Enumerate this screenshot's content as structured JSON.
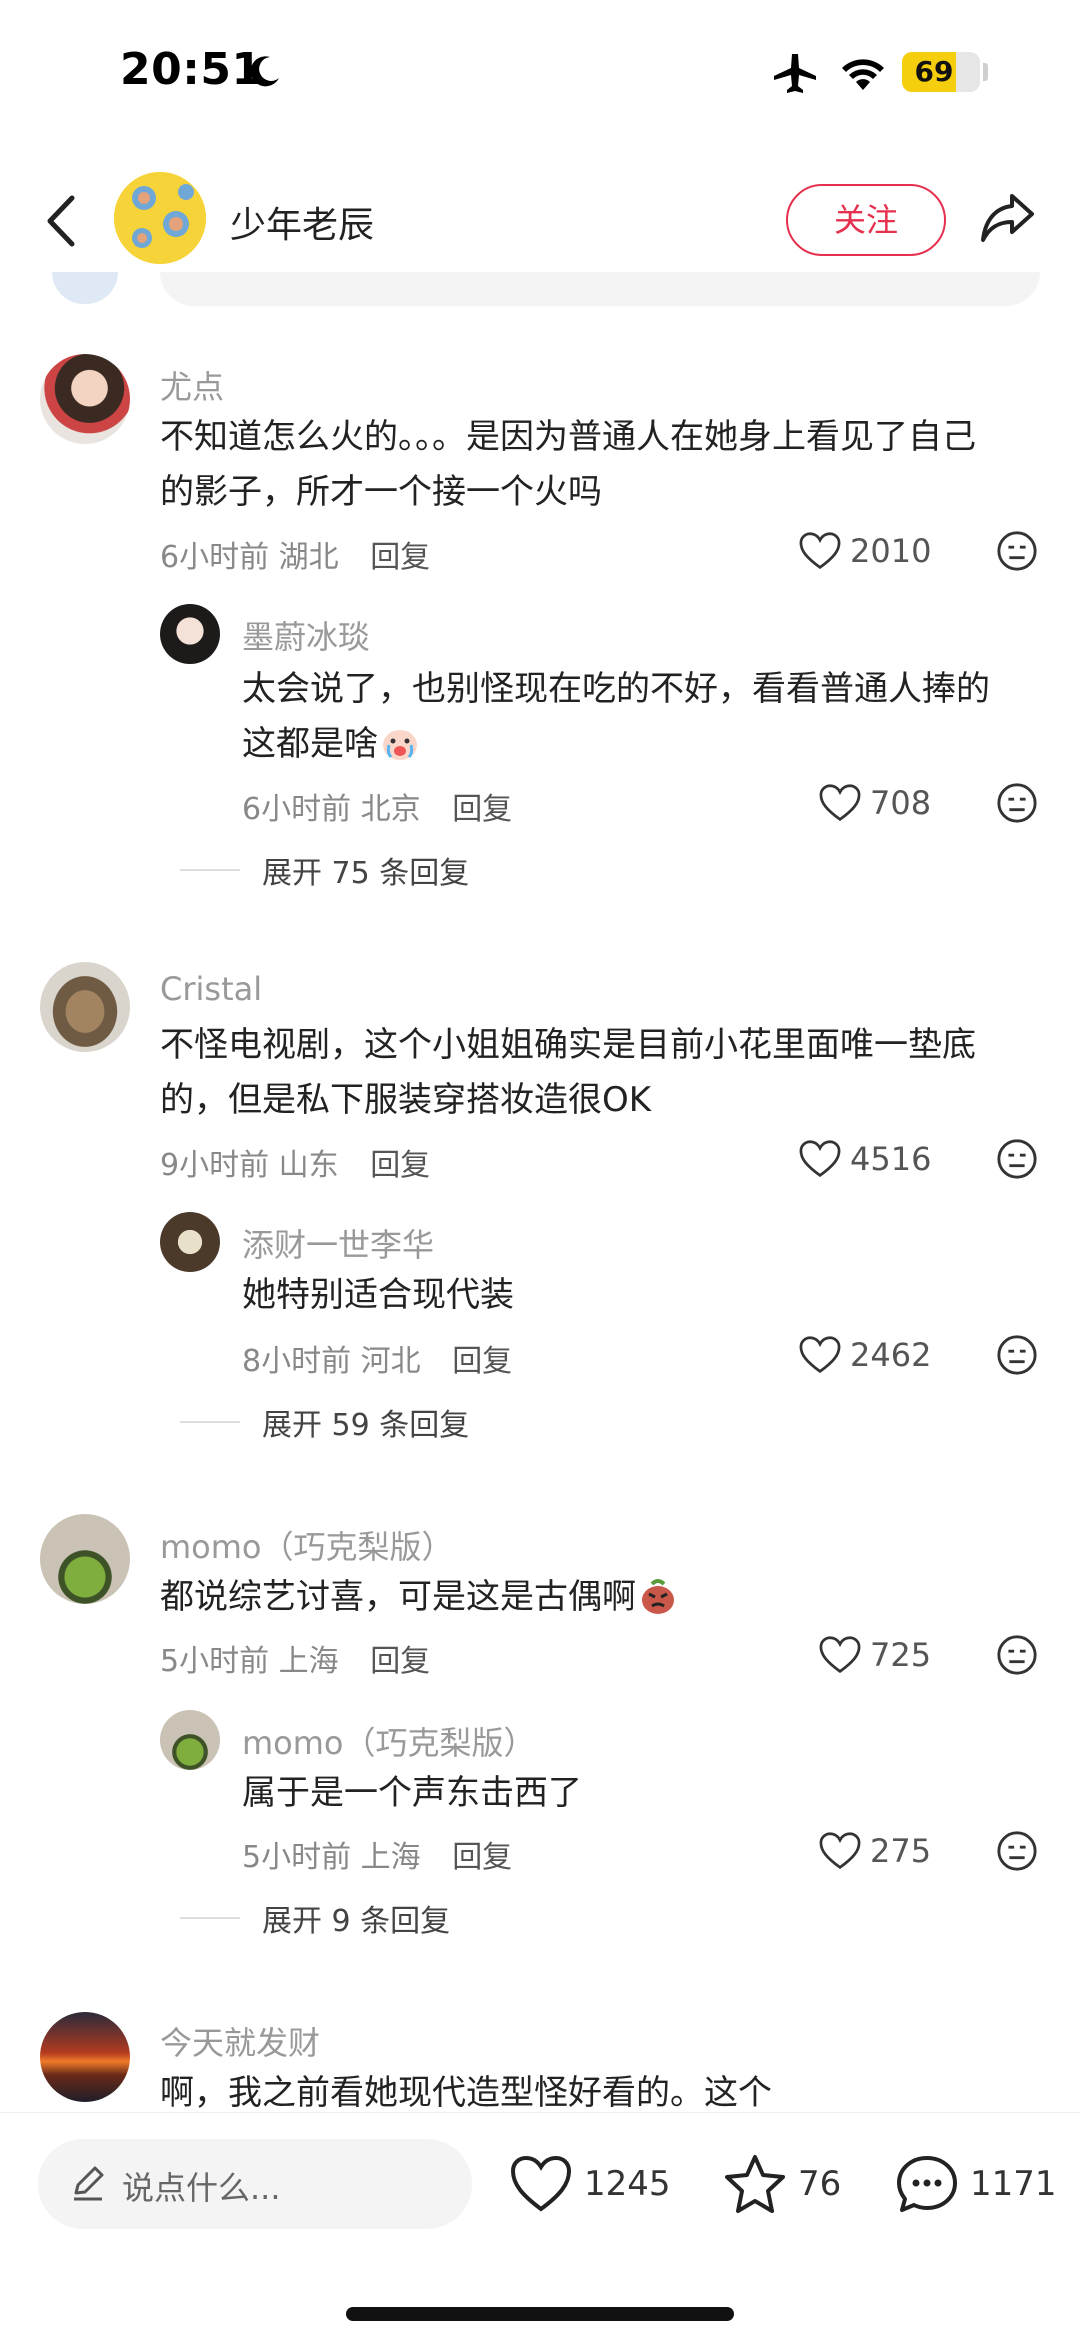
{
  "status_bar": {
    "time": "20:51",
    "battery": "69"
  },
  "header": {
    "author_name": "少年老辰",
    "follow_label": "关注"
  },
  "comments": [
    {
      "username": "尤点",
      "content_lines": [
        "不知道怎么火的。。。是因为普通人在她身上看见了自己",
        "的影子，所才一个接一个火吗"
      ],
      "time": "6小时前",
      "location": "湖北",
      "reply_label": "回复",
      "likes": "2010",
      "replies": [
        {
          "username": "墨蔚冰琰",
          "content_lines": [
            "太会说了，也别怪现在吃的不好，看看普通人捧的",
            "这都是啥"
          ],
          "time": "6小时前",
          "location": "北京",
          "reply_label": "回复",
          "likes": "708"
        }
      ],
      "expand_label": "展开 75 条回复"
    },
    {
      "username": "Cristal",
      "content_lines": [
        "不怪电视剧，这个小姐姐确实是目前小花里面唯一垫底",
        "的，但是私下服装穿搭妆造很OK"
      ],
      "time": "9小时前",
      "location": "山东",
      "reply_label": "回复",
      "likes": "4516",
      "replies": [
        {
          "username": "添财一世李华",
          "content_lines": [
            "她特别适合现代装"
          ],
          "time": "8小时前",
          "location": "河北",
          "reply_label": "回复",
          "likes": "2462"
        }
      ],
      "expand_label": "展开 59 条回复"
    },
    {
      "username": "momo（巧克梨版）",
      "content_lines": [
        "都说综艺讨喜，可是这是古偶啊"
      ],
      "time": "5小时前",
      "location": "上海",
      "reply_label": "回复",
      "likes": "725",
      "replies": [
        {
          "username": "momo（巧克梨版）",
          "content_lines": [
            "属于是一个声东击西了"
          ],
          "time": "5小时前",
          "location": "上海",
          "reply_label": "回复",
          "likes": "275"
        }
      ],
      "expand_label": "展开 9 条回复"
    },
    {
      "username": "今天就发财",
      "content_lines": [
        "啊，我之前看她现代造型怪好看的。这个"
      ]
    }
  ],
  "bottom_bar": {
    "input_placeholder": "说点什么...",
    "likes": "1245",
    "favorites": "76",
    "comments": "1171"
  },
  "colors": {
    "accent": "#e5304e",
    "battery": "#f5cf0e"
  },
  "icons": [
    "back-icon",
    "share-icon",
    "heart-icon",
    "dislike-face-icon",
    "pencil-icon",
    "star-icon",
    "comment-bubble-icon"
  ]
}
